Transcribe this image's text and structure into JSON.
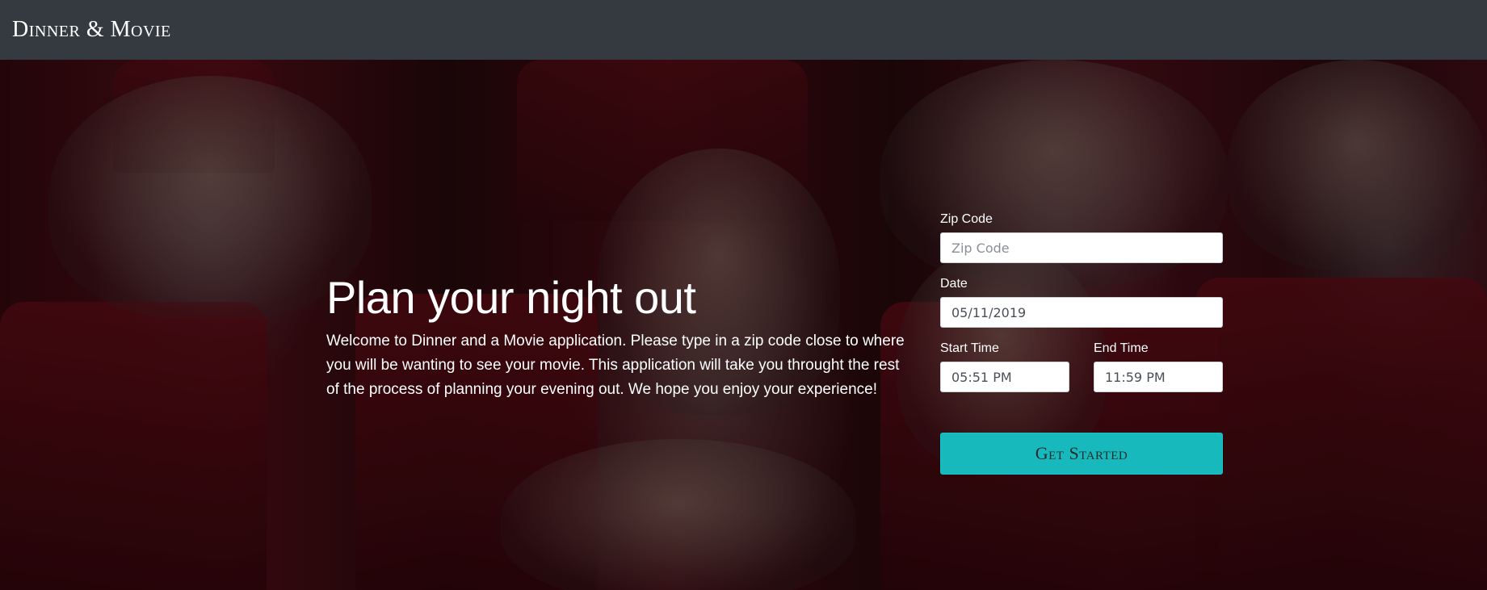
{
  "navbar": {
    "brand": "Dinner & Movie"
  },
  "hero": {
    "title": "Plan your night out",
    "description": "Welcome to Dinner and a Movie application. Please type in a zip code close to where you will be wanting to see your movie. This application will take you throught the rest of the process of planning your evening out. We hope you enjoy your experience!"
  },
  "form": {
    "zip": {
      "label": "Zip Code",
      "placeholder": "Zip Code",
      "value": ""
    },
    "date": {
      "label": "Date",
      "value": "05/11/2019"
    },
    "start_time": {
      "label": "Start Time",
      "value": "05:51 PM"
    },
    "end_time": {
      "label": "End Time",
      "value": "11:59 PM"
    },
    "submit_label": "Get Started"
  },
  "colors": {
    "navbar_bg": "#343a40",
    "button_bg": "#17b9bd"
  }
}
